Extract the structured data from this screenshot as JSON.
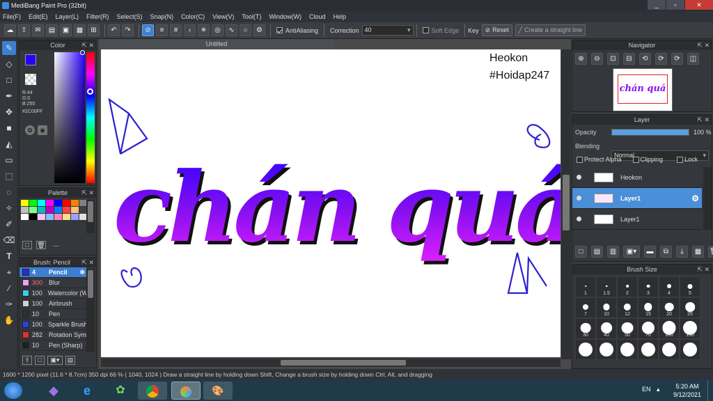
{
  "window": {
    "title": "MediBang Paint Pro (32bit)",
    "min": "_",
    "max": "▫",
    "close": "✕"
  },
  "menu": [
    "File(F)",
    "Edit(E)",
    "Layer(L)",
    "Filter(R)",
    "Select(S)",
    "Snap(N)",
    "Color(C)",
    "View(V)",
    "Tool(T)",
    "Window(W)",
    "Cloud",
    "Help"
  ],
  "toolbar": {
    "antialiasing_label": "AntiAliasing",
    "correction_label": "Correction",
    "correction_value": "40",
    "soft_edge_label": "Soft Edge",
    "key_label": "Key",
    "reset_label": "Reset",
    "straight_line_label": "Create a straight line"
  },
  "color_panel": {
    "title": "Color",
    "r": "R:44",
    "g": "G:0",
    "b": "B:255",
    "hex": "#2C00FF",
    "fg_color": "#2C00FF",
    "bg_color": "#FFFFFF"
  },
  "palette_panel": {
    "title": "Palette",
    "extra": "---",
    "swatches": [
      "#ffff00",
      "#00ff00",
      "#00ffff",
      "#ff00ff",
      "#0000ff",
      "#ff0000",
      "#ff8000",
      "#808080",
      "#c0c0c0",
      "#80ff80",
      "#00c0c0",
      "#c000c0",
      "#0080ff",
      "#ff4040",
      "#ffc080",
      "#404040",
      "#ffffff",
      "#000000",
      "#ffc0ff",
      "#80c0ff",
      "#ff80c0",
      "#ffe080",
      "#a0a0ff",
      "#e0e0e0"
    ]
  },
  "brush_panel": {
    "title": "Brush: Pencil",
    "brushes": [
      {
        "size": "4",
        "name": "Pencil",
        "color": "#2b2bd0"
      },
      {
        "size": "300",
        "name": "Blur",
        "color": "#f0a0f0"
      },
      {
        "size": "100",
        "name": "Watercolor (W",
        "color": "#40c8f0"
      },
      {
        "size": "100",
        "name": "Airbrush",
        "color": "#d0d0d0"
      },
      {
        "size": "10",
        "name": "Pen",
        "color": "#303030"
      },
      {
        "size": "100",
        "name": "Sparkle Brush",
        "color": "#3040e0"
      },
      {
        "size": "282",
        "name": "Rotation Sym",
        "color": "#e03030"
      },
      {
        "size": "10",
        "name": "Pen (Sharp)",
        "color": "#202020"
      }
    ]
  },
  "canvas": {
    "tab_title": "Untitled",
    "watermark_line1": "Heokon",
    "watermark_line2": "#Hoidap247",
    "artwork_text": "chán quá"
  },
  "navigator": {
    "title": "Navigator",
    "preview_text": "chán quá"
  },
  "layer_panel": {
    "title": "Layer",
    "opacity_label": "Opacity",
    "opacity_value": "100 %",
    "opacity_fraction": 1.0,
    "blending_label": "Blending",
    "blending_value": "Normal",
    "protect_alpha": "Protect Alpha",
    "clipping": "Clipping",
    "lock": "Lock",
    "layers": [
      {
        "name": "Heokon",
        "selected": false
      },
      {
        "name": "Layer1",
        "selected": true
      },
      {
        "name": "Layer1",
        "selected": false
      }
    ]
  },
  "brush_size_panel": {
    "title": "Brush Size",
    "sizes": [
      "1",
      "1.5",
      "2",
      "3",
      "4",
      "5",
      "7",
      "10",
      "12",
      "15",
      "20",
      "25",
      "30",
      "40",
      "50",
      "70",
      "100",
      "150",
      "",
      "",
      "",
      "",
      "",
      ""
    ]
  },
  "status": {
    "text": "1600 * 1200 pixel   (11.6 * 8.7cm)   350 dpi   66 %   ( 1040, 1024 )   Draw a straight line by holding down Shift, Change a brush size by holding down Ctrl, Alt, and dragging"
  },
  "taskbar": {
    "lang": "EN",
    "time": "5:20 AM",
    "date": "9/12/2021"
  }
}
